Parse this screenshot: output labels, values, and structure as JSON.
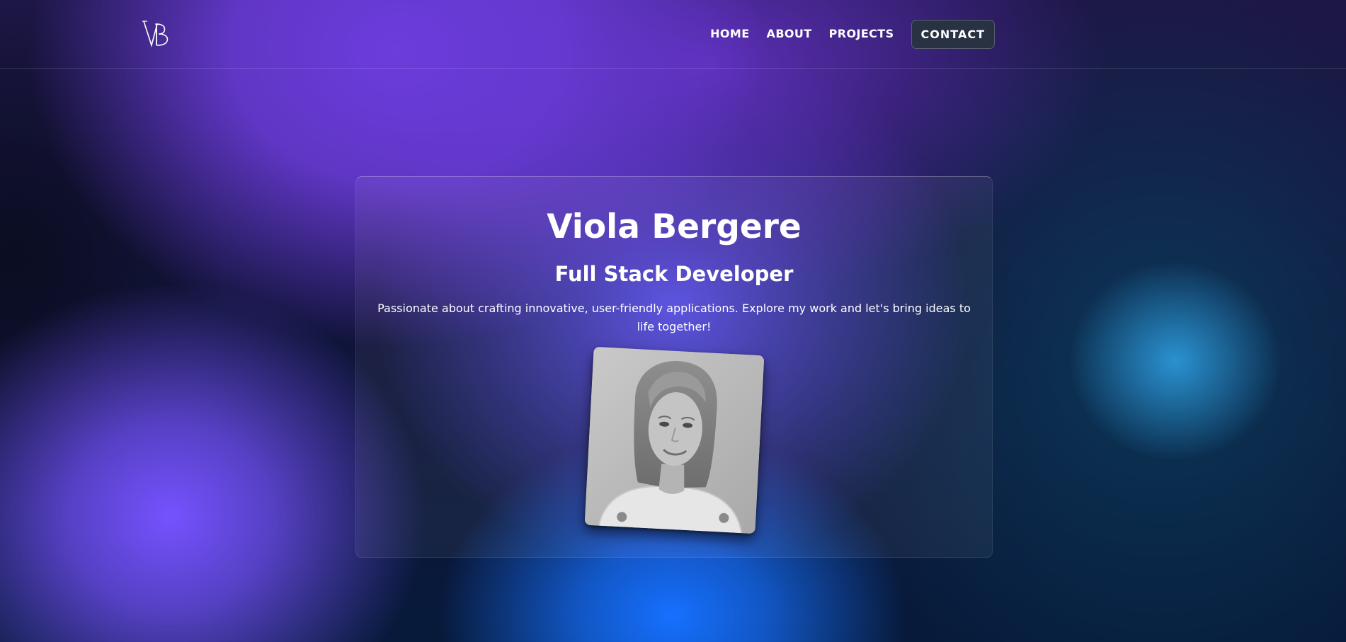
{
  "header": {
    "logo_alt": "VB",
    "nav": [
      {
        "label": "HOME"
      },
      {
        "label": "ABOUT"
      },
      {
        "label": "PROJECTS"
      }
    ],
    "contact_label": "CONTACT"
  },
  "hero": {
    "name": "Viola Bergere",
    "role": "Full Stack Developer",
    "tagline": "Passionate about crafting innovative, user-friendly applications. Explore my work and let's bring ideas to life together!",
    "photo_icon": "profile-photo"
  },
  "colors": {
    "violet": "#6c3cdc",
    "bright_violet": "#7652ff",
    "blue": "#1670ff",
    "teal": "#2c96d7",
    "navy": "#05101c"
  }
}
